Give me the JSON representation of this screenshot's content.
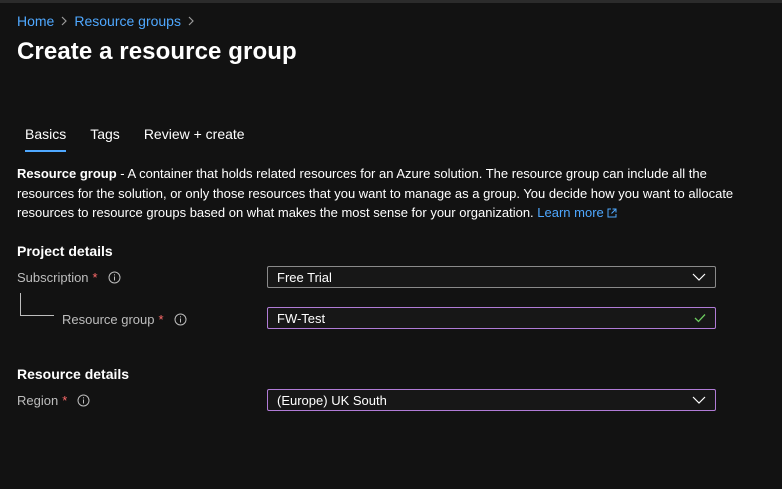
{
  "breadcrumb": {
    "items": [
      "Home",
      "Resource groups"
    ]
  },
  "page": {
    "title": "Create a resource group"
  },
  "tabs": [
    {
      "label": "Basics",
      "active": true
    },
    {
      "label": "Tags",
      "active": false
    },
    {
      "label": "Review + create",
      "active": false
    }
  ],
  "description": {
    "bold": "Resource group",
    "text": " - A container that holds related resources for an Azure solution. The resource group can include all the resources for the solution, or only those resources that you want to manage as a group. You decide how you want to allocate resources to resource groups based on what makes the most sense for your organization. ",
    "link": "Learn more"
  },
  "project_details": {
    "title": "Project details",
    "subscription": {
      "label": "Subscription",
      "required": "*",
      "value": "Free Trial"
    },
    "resource_group": {
      "label": "Resource group",
      "required": "*",
      "value": "FW-Test"
    }
  },
  "resource_details": {
    "title": "Resource details",
    "region": {
      "label": "Region",
      "required": "*",
      "value": "(Europe) UK South"
    }
  },
  "colors": {
    "background": "#121212",
    "link": "#4fa8ff",
    "required": "#ff6b6b",
    "focus_border": "#b07bd6",
    "valid_check": "#6ccb5f"
  },
  "icons": [
    "chevron-right-icon",
    "external-link-icon",
    "info-icon",
    "chevron-down-icon",
    "checkmark-icon"
  ]
}
